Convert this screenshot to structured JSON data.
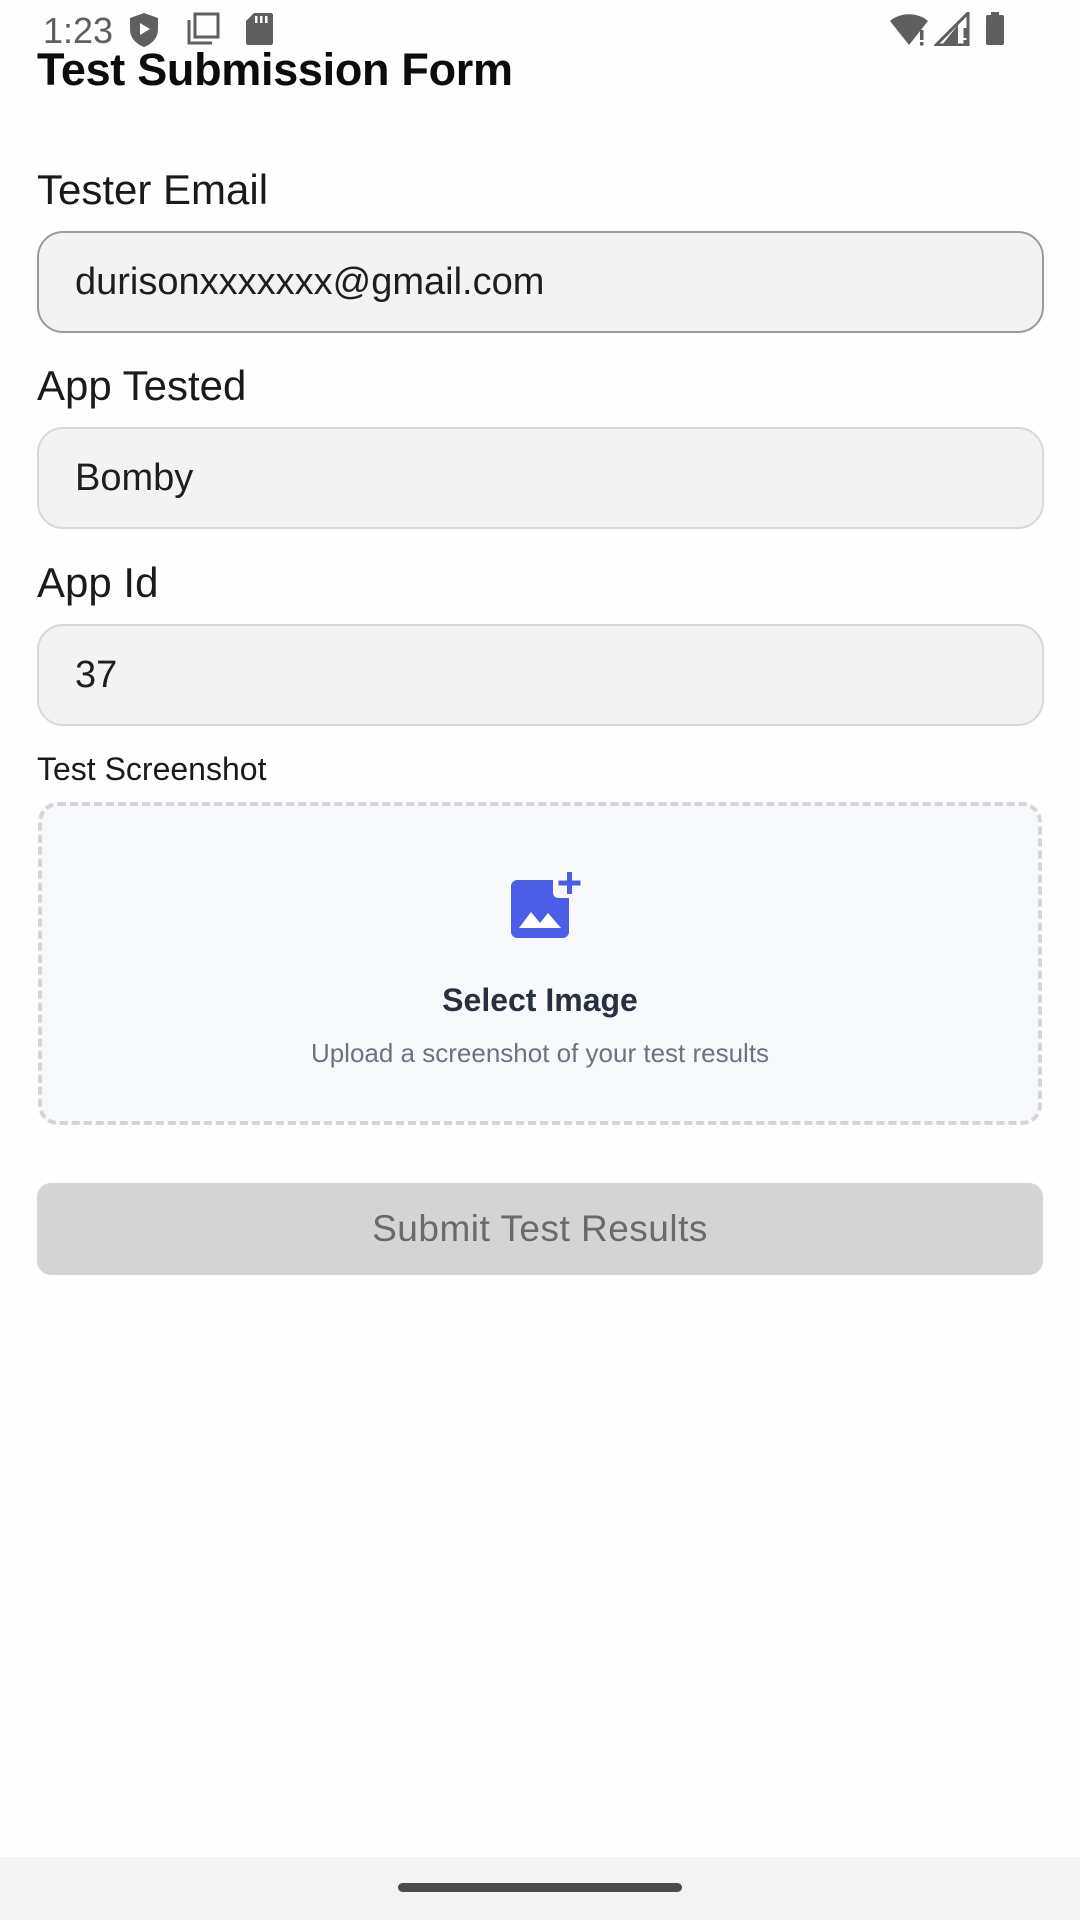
{
  "status_bar": {
    "time": "1:23",
    "icons_left": [
      "shield-icon",
      "screen-icon",
      "sd-card-icon"
    ],
    "icons_right": [
      "wifi-icon",
      "signal-icon",
      "battery-icon"
    ]
  },
  "page": {
    "title": "Test Submission Form"
  },
  "form": {
    "email": {
      "label": "Tester Email",
      "value": "durisonxxxxxxx@gmail.com"
    },
    "app_tested": {
      "label": "App Tested",
      "value": "Bomby"
    },
    "app_id": {
      "label": "App Id",
      "value": "37"
    },
    "screenshot": {
      "label": "Test Screenshot",
      "icon": "add-photo-icon",
      "title": "Select Image",
      "subtitle": "Upload a screenshot of your test results"
    },
    "submit_label": "Submit Test Results"
  },
  "colors": {
    "accent": "#4a5ee8",
    "button_disabled_bg": "#d4d4d4",
    "button_disabled_text": "#6a6a6a"
  }
}
